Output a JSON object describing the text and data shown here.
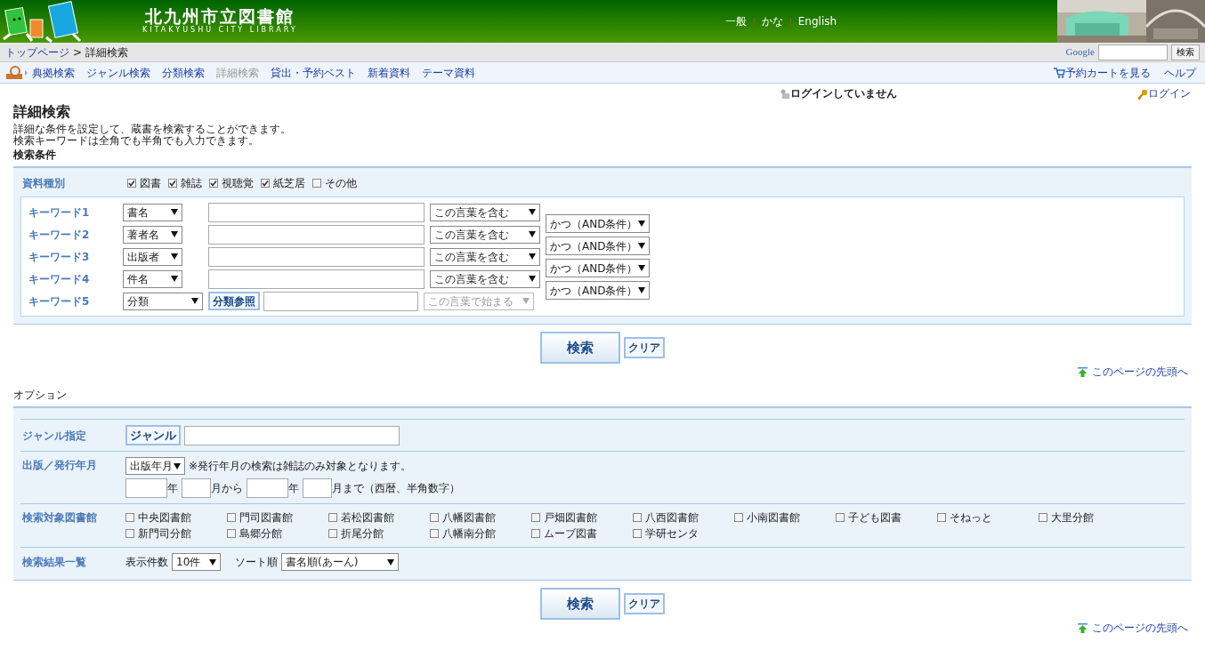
{
  "header": {
    "title": "北九州市立図書館",
    "subtitle": "KITAKYUSHU CITY LIBRARY",
    "languages": [
      "一般",
      "かな",
      "English"
    ]
  },
  "breadcrumb": {
    "items": [
      "トップページ"
    ],
    "separator": ">",
    "current": "詳細検索"
  },
  "google_search": {
    "logo": "Google",
    "button": "検索"
  },
  "nav": {
    "items": [
      {
        "label": "典拠検索",
        "selected": false
      },
      {
        "label": "ジャンル検索",
        "selected": false
      },
      {
        "label": "分類検索",
        "selected": false
      },
      {
        "label": "詳細検索",
        "selected": true
      },
      {
        "label": "貸出・予約ベスト",
        "selected": false
      },
      {
        "label": "新着資料",
        "selected": false
      },
      {
        "label": "テーマ資料",
        "selected": false
      }
    ],
    "right": [
      "予約カートを見る",
      "ヘルプ"
    ]
  },
  "login_status": "ログインしていません",
  "login_link": "ログイン",
  "page_title": "詳細検索",
  "description": [
    "詳細な条件を設定して、蔵書を検索することができます。",
    "検索キーワードは全角でも半角でも入力できます。"
  ],
  "conditions": {
    "heading": "検索条件",
    "material_label": "資料種別",
    "materials": [
      {
        "label": "図書",
        "checked": true
      },
      {
        "label": "雑誌",
        "checked": true
      },
      {
        "label": "視聴覚",
        "checked": true
      },
      {
        "label": "紙芝居",
        "checked": true
      },
      {
        "label": "その他",
        "checked": false
      }
    ],
    "keywords": [
      {
        "label": "キーワード1",
        "field": "書名",
        "kind": "plain",
        "match": "この言葉を含む",
        "match_disabled": false,
        "conjunction": "かつ（AND条件）"
      },
      {
        "label": "キーワード2",
        "field": "著者名",
        "kind": "plain",
        "match": "この言葉を含む",
        "match_disabled": false,
        "conjunction": "かつ（AND条件）"
      },
      {
        "label": "キーワード3",
        "field": "出版者",
        "kind": "plain",
        "match": "この言葉を含む",
        "match_disabled": false,
        "conjunction": "かつ（AND条件）"
      },
      {
        "label": "キーワード4",
        "field": "件名",
        "kind": "plain",
        "match": "この言葉を含む",
        "match_disabled": false,
        "conjunction": "かつ（AND条件）"
      },
      {
        "label": "キーワード5",
        "field": "分類",
        "kind": "lookup",
        "button": "分類参照",
        "match": "この言葉で始まる",
        "match_disabled": true
      }
    ]
  },
  "actions": [
    {
      "search": "検索",
      "clear": "クリア",
      "top_link": "このページの先頭へ"
    }
  ],
  "options": {
    "heading": "オプション",
    "genre": {
      "label": "ジャンル指定",
      "button": "ジャンル"
    },
    "date": {
      "label": "出版／発行年月",
      "select": "出版年月",
      "note": "※発行年月の検索は雑誌のみ対象となります。",
      "year1": "年",
      "month1": "月から",
      "year2": "年",
      "month2": "月まで（西暦、半角数字）"
    },
    "libraries": {
      "label": "検索対象図書館",
      "items": [
        {
          "label": "中央図書館",
          "checked": false
        },
        {
          "label": "門司図書館",
          "checked": false
        },
        {
          "label": "若松図書館",
          "checked": false
        },
        {
          "label": "八幡図書館",
          "checked": false
        },
        {
          "label": "戸畑図書館",
          "checked": false
        },
        {
          "label": "八西図書館",
          "checked": false
        },
        {
          "label": "小南図書館",
          "checked": false
        },
        {
          "label": "子ども図書",
          "checked": false
        },
        {
          "label": "そねっと",
          "checked": false
        },
        {
          "label": "大里分館",
          "checked": false
        },
        {
          "label": "新門司分館",
          "checked": false
        },
        {
          "label": "島郷分館",
          "checked": false
        },
        {
          "label": "折尾分館",
          "checked": false
        },
        {
          "label": "八幡南分館",
          "checked": false
        },
        {
          "label": "ムーブ図書",
          "checked": false
        },
        {
          "label": "学研センタ",
          "checked": false
        }
      ]
    },
    "results": {
      "label": "検索結果一覧",
      "count_label": "表示件数",
      "count": "10件",
      "sort_label": "ソート順",
      "sort": "書名順(あーん)"
    }
  },
  "bottom_actions": {
    "search": "検索",
    "clear": "クリア",
    "top_link": "このページの先頭へ"
  }
}
